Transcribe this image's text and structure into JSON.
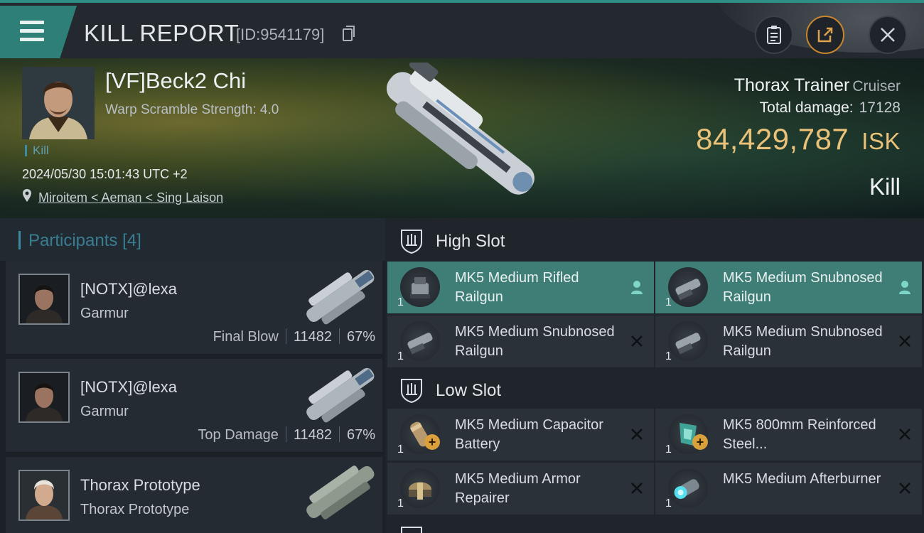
{
  "header": {
    "title": "KILL REPORT",
    "kill_id": "[ID:9541179]"
  },
  "victim": {
    "name": "[VF]Beck2 Chi",
    "warp_scramble": "Warp Scramble Strength: 4.0",
    "kill_tag": "Kill",
    "datetime": "2024/05/30 15:01:43 UTC +2",
    "location": "Miroitem < Aeman < Sing Laison",
    "ship_name": "Thorax Trainer",
    "ship_class": "Cruiser",
    "total_damage_label": "Total damage:",
    "total_damage": "17128",
    "isk_value": "84,429,787",
    "isk_unit": "ISK",
    "result": "Kill"
  },
  "participants": {
    "title": "Participants",
    "count": "[4]",
    "rows": [
      {
        "name": "[NOTX]@lexa",
        "ship": "Garmur",
        "label": "Final Blow",
        "damage": "11482",
        "percent": "67%"
      },
      {
        "name": "[NOTX]@lexa",
        "ship": "Garmur",
        "label": "Top Damage",
        "damage": "11482",
        "percent": "67%"
      },
      {
        "name": "Thorax Prototype",
        "ship": "Thorax Prototype"
      }
    ]
  },
  "high_slot": {
    "title": "High Slot",
    "modules": [
      {
        "name": "MK5 Medium Rifled Railgun",
        "qty": "1",
        "status": "fitted"
      },
      {
        "name": "MK5 Medium Snubnosed Railgun",
        "qty": "1",
        "status": "fitted"
      },
      {
        "name": "MK5 Medium Snubnosed Railgun",
        "qty": "1",
        "status": "destroyed"
      },
      {
        "name": "MK5 Medium Snubnosed Railgun",
        "qty": "1",
        "status": "destroyed"
      }
    ]
  },
  "low_slot": {
    "title": "Low Slot",
    "modules": [
      {
        "name": "MK5 Medium Capacitor Battery",
        "qty": "1",
        "status": "destroyed"
      },
      {
        "name": "MK5 800mm Reinforced Steel...",
        "qty": "1",
        "status": "destroyed"
      },
      {
        "name": "MK5 Medium Armor Repairer",
        "qty": "1",
        "status": "destroyed"
      },
      {
        "name": "MK5 Medium Afterburner",
        "qty": "1",
        "status": "destroyed"
      }
    ]
  },
  "colors": {
    "accent_teal": "#3e7e77",
    "isk_gold": "#e9c178",
    "participants_blue": "#3a7d92"
  }
}
